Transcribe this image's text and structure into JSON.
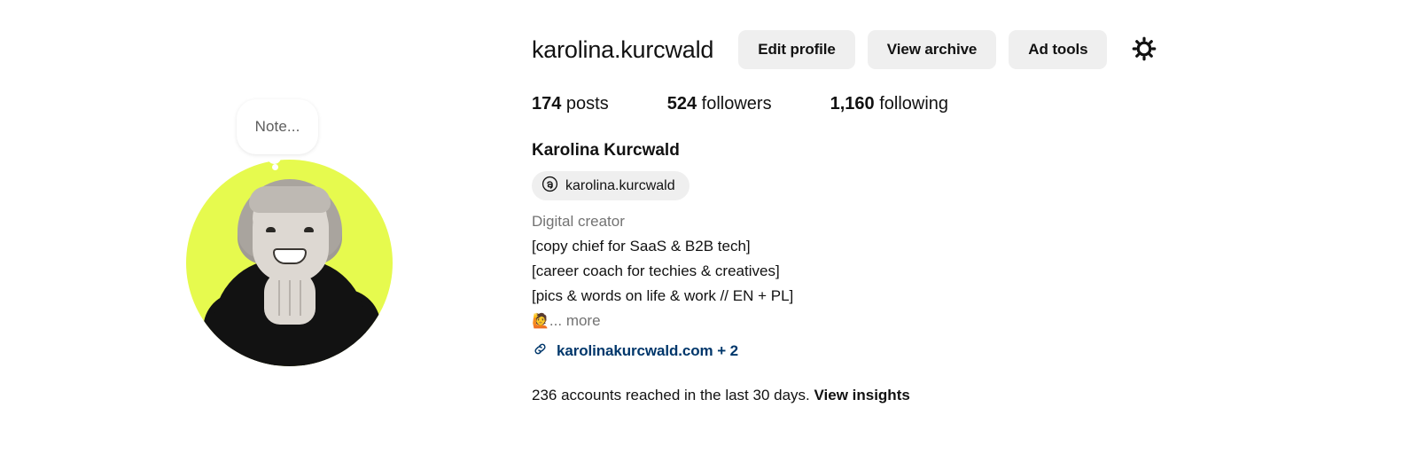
{
  "profile": {
    "username": "karolina.kurcwald",
    "full_name": "Karolina Kurcwald",
    "category": "Digital creator",
    "threads_handle": "karolina.kurcwald",
    "bio_lines": [
      "[copy chief for SaaS & B2B tech]",
      "[career coach for techies & creatives]",
      "[pics & words on life & work // EN + PL]"
    ],
    "bio_emoji": "🙋",
    "bio_more_label": "... more",
    "link_text": "karolinakurcwald.com + 2",
    "note_text": "Note..."
  },
  "actions": {
    "edit_profile": "Edit profile",
    "view_archive": "View archive",
    "ad_tools": "Ad tools",
    "settings_icon": "gear-icon"
  },
  "stats": [
    {
      "value": "174",
      "label": " posts"
    },
    {
      "value": "524",
      "label": " followers"
    },
    {
      "value": "1,160",
      "label": " following"
    }
  ],
  "insights": {
    "text": "236 accounts reached in the last 30 days. ",
    "link_label": "View insights"
  },
  "colors": {
    "avatar_background": "#E6FA4E",
    "button_background": "#EFEFEF",
    "link": "#00376B",
    "muted_text": "#737373",
    "primary_text": "#121212"
  },
  "icons": {
    "threads": "threads-icon",
    "link": "link-chain-icon",
    "gear": "gear-icon"
  }
}
